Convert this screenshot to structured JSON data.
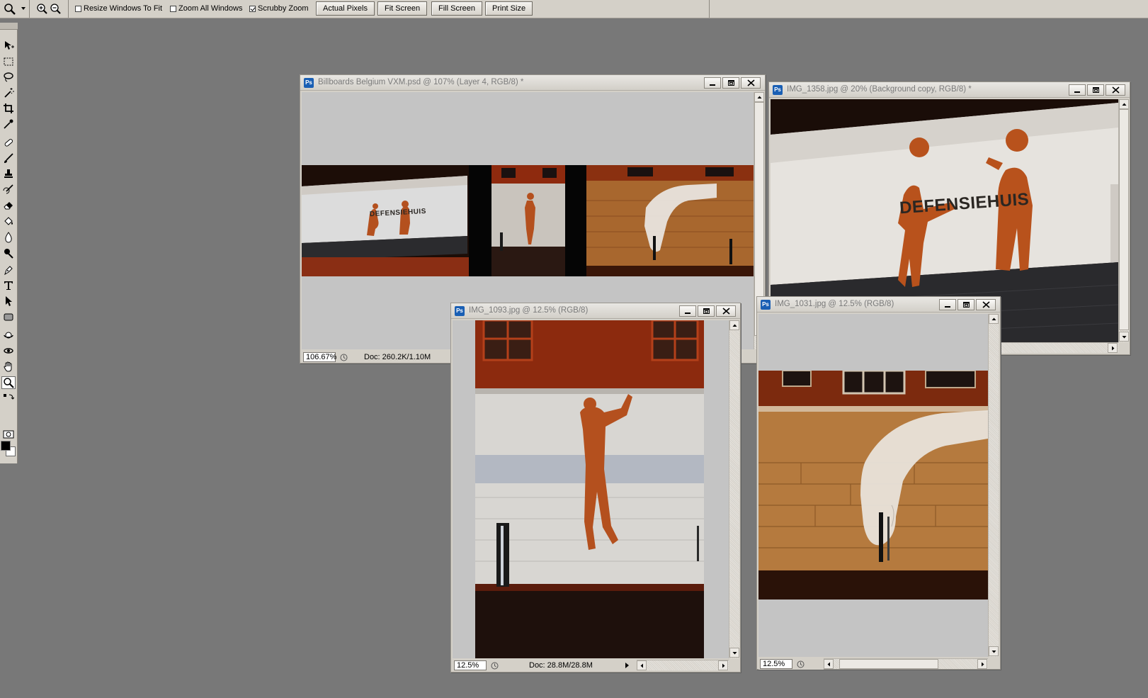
{
  "options_bar": {
    "resize_windows_label": "Resize Windows To Fit",
    "resize_windows_checked": false,
    "zoom_all_label": "Zoom All Windows",
    "zoom_all_checked": false,
    "scrubby_zoom_label": "Scrubby Zoom",
    "scrubby_zoom_checked": true,
    "actual_pixels_label": "Actual Pixels",
    "fit_screen_label": "Fit Screen",
    "fill_screen_label": "Fill Screen",
    "print_size_label": "Print Size"
  },
  "toolbox": {
    "active_tool": "zoom-tool",
    "tools": [
      "move-tool",
      "marquee-tool",
      "lasso-tool",
      "magic-wand-tool",
      "crop-tool",
      "eyedropper-tool",
      "healing-brush-tool",
      "brush-tool",
      "clone-stamp-tool",
      "history-brush-tool",
      "eraser-tool",
      "paint-bucket-tool",
      "blur-tool",
      "dodge-tool",
      "pen-tool",
      "type-tool",
      "path-selection-tool",
      "shape-tool",
      "3d-rotate-tool",
      "3d-orbit-tool",
      "hand-tool",
      "zoom-tool"
    ],
    "foreground_color": "#000000",
    "background_color": "#ffffff"
  },
  "windows": {
    "billboards": {
      "title": "Billboards Belgium  VXM.psd @ 107% (Layer 4, RGB/8) *",
      "zoom": "106.67%",
      "doc_info": "Doc: 260.2K/1.10M"
    },
    "img1358": {
      "title": "IMG_1358.jpg @ 20% (Background copy, RGB/8) *",
      "sign_text": "DEFENSIEHUIS"
    },
    "img1093": {
      "title": "IMG_1093.jpg @ 12.5% (RGB/8)",
      "zoom": "12.5%",
      "doc_info": "Doc: 28.8M/28.8M"
    },
    "img1031": {
      "title": "IMG_1031.jpg @ 12.5% (RGB/8)",
      "zoom": "12.5%"
    }
  },
  "colors": {
    "workspace": "#787878",
    "chrome": "#d4d0c8",
    "canvas_bg": "#c4c4c4",
    "ps_icon": "#1a5fb4"
  }
}
